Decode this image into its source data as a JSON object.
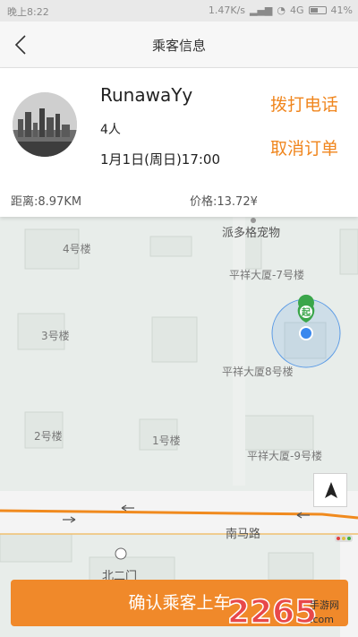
{
  "status_bar": {
    "time": "晚上8:22",
    "network_speed": "1.47K/s",
    "network_type": "4G",
    "battery": "41%"
  },
  "header": {
    "title": "乘客信息",
    "back_icon": "chevron-left-icon"
  },
  "passenger": {
    "name": "RunawaYy",
    "count": "4人",
    "time": "1月1日(周日)17:00",
    "call_label": "拨打电话",
    "cancel_label": "取消订单",
    "distance": "距离:8.97KM",
    "price": "价格:13.72¥"
  },
  "map": {
    "labels": {
      "pet": "派多格宠物",
      "b4": "4号楼",
      "pingxiang7": "平祥大厦-7号楼",
      "b3": "3号楼",
      "pingxiang8": "平祥大厦8号楼",
      "b2": "2号楼",
      "b1": "1号楼",
      "pingxiang9": "平祥大厦-9号楼",
      "road": "南马路",
      "gate": "北二门"
    },
    "start_marker": "起",
    "location_icon": "navigation-arrow-icon",
    "road_color": "#f08a1e",
    "accuracy_color": "#5b9be6"
  },
  "footer": {
    "confirm_label": "确认乘客上车"
  },
  "watermark": {
    "number": "2265",
    "site": "手游网",
    "domain": ".com"
  },
  "colors": {
    "accent": "#f0861e"
  }
}
